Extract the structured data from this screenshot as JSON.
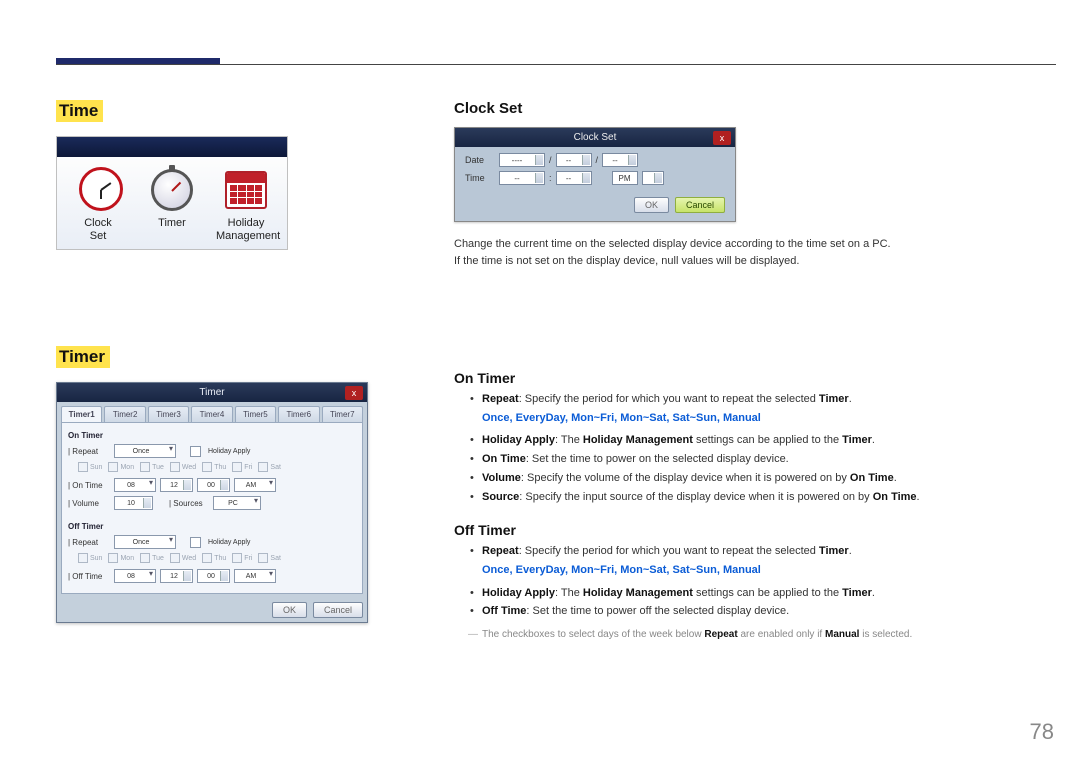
{
  "headings": {
    "time": "Time",
    "timer_hl": "Timer",
    "clock_set": "Clock Set",
    "on_timer": "On Timer",
    "off_timer": "Off Timer"
  },
  "time_panel": {
    "items": [
      {
        "label_line1": "Clock",
        "label_line2": "Set"
      },
      {
        "label_line1": "Timer",
        "label_line2": ""
      },
      {
        "label_line1": "Holiday",
        "label_line2": "Management"
      }
    ]
  },
  "clockset_dialog": {
    "title": "Clock Set",
    "close": "x",
    "date_label": "Date",
    "time_label": "Time",
    "date_sep": "/",
    "time_sep": ":",
    "ampm": "PM",
    "placeholder_long": "----",
    "placeholder_short": "--",
    "ok": "OK",
    "cancel": "Cancel"
  },
  "clockset_text": {
    "line1": "Change the current time on the selected display device according to the time set on a PC.",
    "line2": "If the time is not set on the display device, null values will be displayed."
  },
  "timer_dialog": {
    "title": "Timer",
    "close": "x",
    "tabs": [
      "Timer1",
      "Timer2",
      "Timer3",
      "Timer4",
      "Timer5",
      "Timer6",
      "Timer7"
    ],
    "on_timer_label": "On Timer",
    "off_timer_label": "Off Timer",
    "repeat_label": "| Repeat",
    "repeat_value": "Once",
    "holiday_apply": "Holiday Apply",
    "days": [
      "Sun",
      "Mon",
      "Tue",
      "Wed",
      "Thu",
      "Fri",
      "Sat"
    ],
    "on_time_label": "| On Time",
    "off_time_label": "| Off Time",
    "time_hh": "08",
    "time_hh_off": "08",
    "time_mm": "12",
    "time_mm2": "00",
    "time_ampm": "AM",
    "volume_label": "| Volume",
    "volume_value": "10",
    "sources_label": "| Sources",
    "sources_value": "PC",
    "ok": "OK",
    "cancel": "Cancel"
  },
  "on_timer_bullets": {
    "repeat_prefix": "Repeat",
    "repeat_text": ": Specify the period for which you want to repeat the selected ",
    "timer_word": "Timer",
    "options": "Once, EveryDay, Mon~Fri, Mon~Sat, Sat~Sun, Manual",
    "holiday_prefix": "Holiday Apply",
    "holiday_mid": ": The ",
    "holiday_mgmt": "Holiday Management",
    "holiday_suffix": " settings can be applied to the ",
    "ontime_prefix": "On Time",
    "ontime_text": ": Set the time to power on the selected display device.",
    "volume_prefix": "Volume",
    "volume_text": ": Specify the volume of the display device when it is powered on by ",
    "ontime_word": "On Time",
    "source_prefix": "Source",
    "source_text": ": Specify the input source of the display device when it is powered on by "
  },
  "off_timer_bullets": {
    "repeat_prefix": "Repeat",
    "repeat_text": ": Specify the period for which you want to repeat the selected ",
    "timer_word": "Timer",
    "options": "Once, EveryDay, Mon~Fri, Mon~Sat, Sat~Sun, Manual",
    "holiday_prefix": "Holiday Apply",
    "holiday_mid": ": The ",
    "holiday_mgmt": "Holiday Management",
    "holiday_suffix": " settings can be applied to the ",
    "offtime_prefix": "Off Time",
    "offtime_text": ": Set the time to power off the selected display device."
  },
  "footnote": {
    "pre": "The checkboxes to select days of the week below ",
    "repeat": "Repeat",
    "mid": " are enabled only if ",
    "manual": "Manual",
    "post": " is selected."
  },
  "page_number": "78"
}
